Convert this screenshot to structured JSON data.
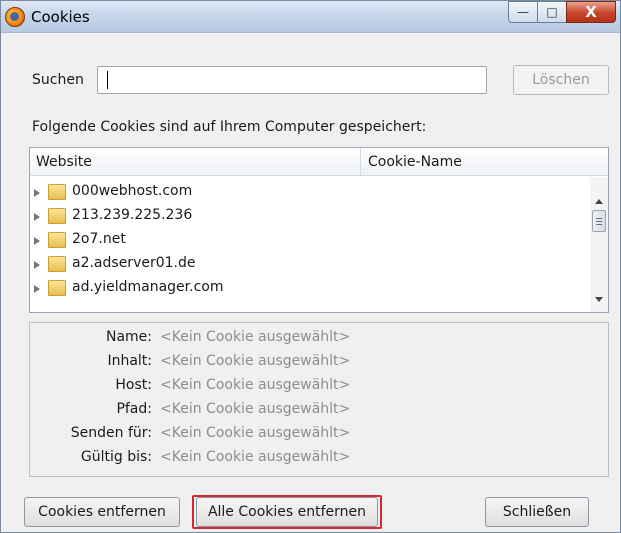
{
  "window": {
    "title": "Cookies",
    "icon": "firefox-icon",
    "controls": {
      "minimize": "—",
      "maximize": "□",
      "close": "X"
    }
  },
  "search": {
    "label": "Suchen",
    "value": "",
    "placeholder": "",
    "clear_button": "Löschen"
  },
  "info_text": "Folgende Cookies sind auf Ihrem Computer gespeichert:",
  "tree": {
    "columns": [
      "Website",
      "Cookie-Name"
    ],
    "rows": [
      "000webhost.com",
      "213.239.225.236",
      "2o7.net",
      "a2.adserver01.de",
      "ad.yieldmanager.com"
    ]
  },
  "details": {
    "fields": [
      {
        "label": "Name:",
        "value": "<Kein Cookie ausgewählt>"
      },
      {
        "label": "Inhalt:",
        "value": "<Kein Cookie ausgewählt>"
      },
      {
        "label": "Host:",
        "value": "<Kein Cookie ausgewählt>"
      },
      {
        "label": "Pfad:",
        "value": "<Kein Cookie ausgewählt>"
      },
      {
        "label": "Senden für:",
        "value": "<Kein Cookie ausgewählt>"
      },
      {
        "label": "Gültig bis:",
        "value": "<Kein Cookie ausgewählt>"
      }
    ]
  },
  "buttons": {
    "remove": "Cookies entfernen",
    "remove_all": "Alle Cookies entfernen",
    "close": "Schließen"
  },
  "colors": {
    "highlight_outline": "#d12b2b"
  }
}
